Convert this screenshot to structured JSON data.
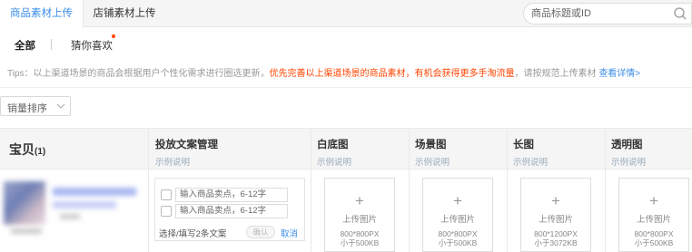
{
  "tabs": [
    {
      "label": "商品素材上传",
      "active": true
    },
    {
      "label": "店铺素材上传",
      "active": false
    }
  ],
  "search": {
    "placeholder": "商品标题或ID"
  },
  "subtabs": [
    {
      "label": "全部",
      "active": true
    },
    {
      "label": "猜你喜欢",
      "active": false,
      "dot": true
    }
  ],
  "tips": {
    "prefix": "Tips：以上渠道场景的商品会根据用户个性化需求进行圈选更新，",
    "warning": "优先完善以上渠道场景的商品素材，有机会获得更多手淘流量",
    "suffix": "，请按规范上传素材 ",
    "link": "查看详情>"
  },
  "sort": {
    "label": "销量排序"
  },
  "table": {
    "product_header": "宝贝",
    "product_count": "(1)",
    "columns": [
      {
        "title": "投放文案管理",
        "sub": "示例说明"
      },
      {
        "title": "白底图",
        "sub": "示例说明"
      },
      {
        "title": "场景图",
        "sub": "示例说明"
      },
      {
        "title": "长图",
        "sub": "示例说明"
      },
      {
        "title": "透明图",
        "sub": "示例说明"
      }
    ]
  },
  "copy_box": {
    "input_placeholder_1": "输入商品卖点，6-12字",
    "input_placeholder_2": "输入商品卖点，6-12字",
    "choose_text": "选择/填写2条文案",
    "confirm": "确认",
    "cancel": "取消"
  },
  "uploads": [
    {
      "label": "上传图片",
      "size1": "800*800PX",
      "size2": "小于500KB"
    },
    {
      "label": "上传图片",
      "size1": "800*800PX",
      "size2": "小于500KB"
    },
    {
      "label": "上传图片",
      "size1": "800*1200PX",
      "size2": "小于3072KB"
    },
    {
      "label": "上传图片",
      "size1": "800*800PX",
      "size2": "小于500KB"
    }
  ],
  "colors": {
    "accent": "#3c8ee8",
    "warning": "#ff4400"
  }
}
